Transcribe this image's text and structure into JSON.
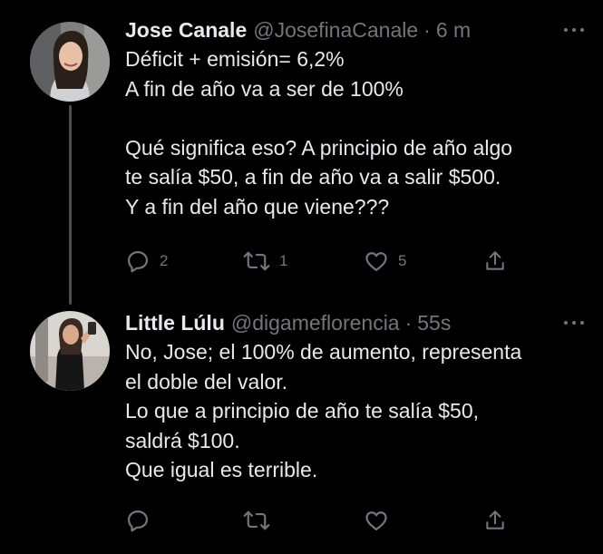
{
  "thread": {
    "tweets": [
      {
        "name": "Jose Canale",
        "handle": "@JosefinaCanale",
        "separator": "·",
        "time": "6 m",
        "lines": [
          "Déficit + emisión= 6,2%",
          "A fin de año va a ser de 100%",
          "",
          "Qué significa eso? A principio de año algo",
          "te salía $50, a fin de año va a salir $500.",
          "Y a fin del año que viene???"
        ],
        "actions": {
          "reply_count": "2",
          "retweet_count": "1",
          "like_count": "5"
        }
      },
      {
        "name": "Little Lúlu",
        "handle": "@digameflorencia",
        "separator": "·",
        "time": "55s",
        "lines": [
          "No, Jose; el 100% de aumento, representa",
          "el doble del valor.",
          "Lo que a principio de año te salía $50,",
          "saldrá $100.",
          "Que igual es terrible."
        ],
        "actions": {
          "reply_count": "",
          "retweet_count": "",
          "like_count": ""
        }
      }
    ]
  },
  "icons": {
    "reply": "reply-icon",
    "retweet": "retweet-icon",
    "like": "heart-icon",
    "share": "share-icon",
    "more": "more-icon"
  },
  "colors": {
    "background": "#000000",
    "text": "#e7e9ea",
    "secondary": "#71767b",
    "thread_line": "#4a4f54"
  }
}
